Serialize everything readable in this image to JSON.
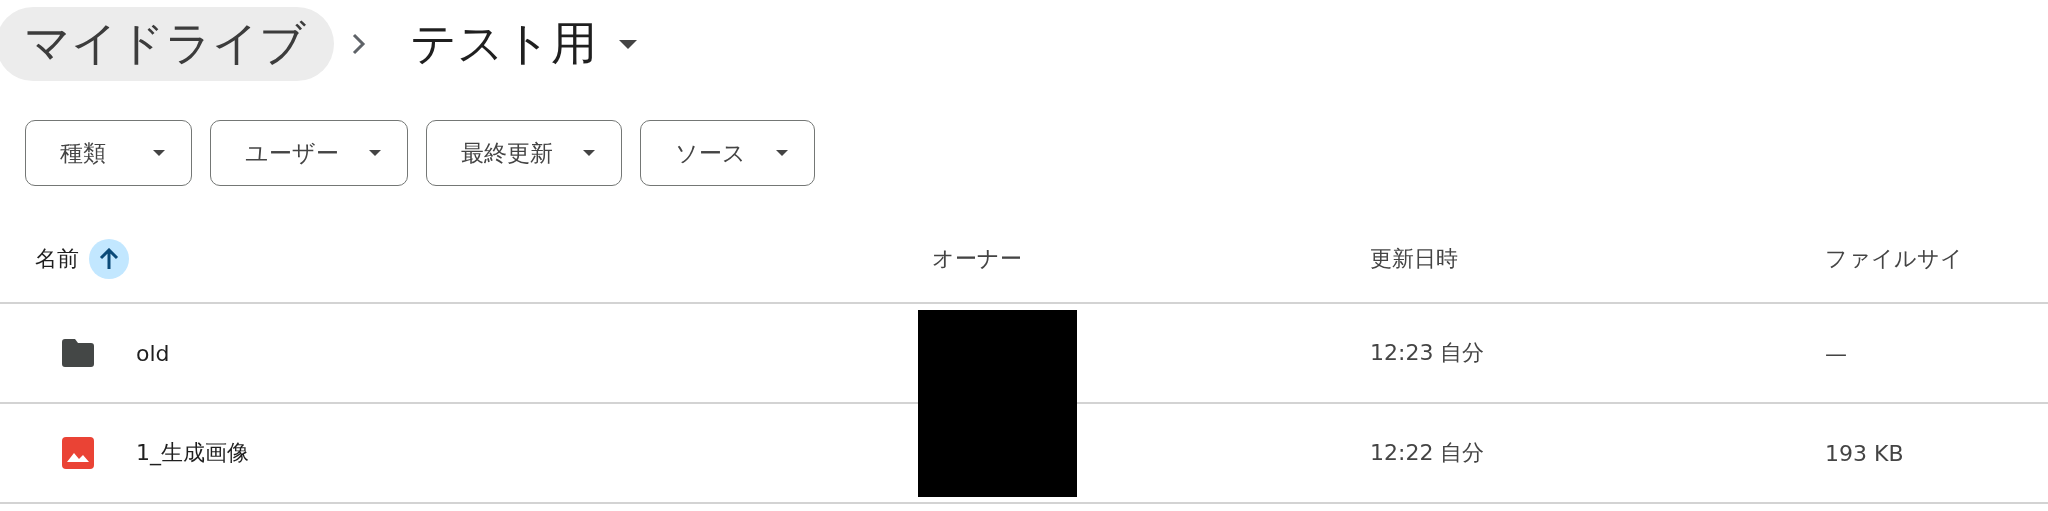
{
  "breadcrumb": [
    {
      "label": "マイドライブ",
      "current": false
    },
    {
      "label": "テスト用",
      "current": true
    }
  ],
  "filters": [
    {
      "label": "種類"
    },
    {
      "label": "ユーザー"
    },
    {
      "label": "最終更新"
    },
    {
      "label": "ソース"
    }
  ],
  "table": {
    "columns": [
      {
        "label": "名前",
        "sorted": true
      },
      {
        "label": "オーナー",
        "sorted": false
      },
      {
        "label": "更新日時",
        "sorted": false
      },
      {
        "label": "ファイルサイ",
        "sorted": false
      }
    ],
    "rows": [
      {
        "kind": "folder",
        "name": "old",
        "modified": "12:23 自分",
        "size": "—"
      },
      {
        "kind": "image",
        "name": "1_生成画像",
        "modified": "12:22 自分",
        "size": "193 KB"
      }
    ]
  }
}
